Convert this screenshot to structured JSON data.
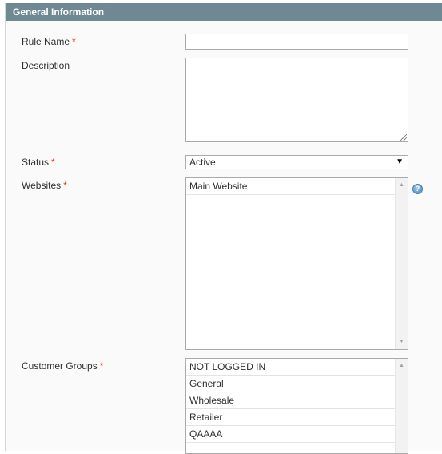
{
  "panel": {
    "title": "General Information"
  },
  "form": {
    "rule_name": {
      "label": "Rule Name",
      "required_mark": "*",
      "value": "",
      "placeholder": ""
    },
    "description": {
      "label": "Description",
      "value": ""
    },
    "status": {
      "label": "Status",
      "required_mark": "*",
      "selected": "Active"
    },
    "websites": {
      "label": "Websites",
      "required_mark": "*",
      "options": [
        "Main Website"
      ],
      "help_icon": "help-icon"
    },
    "customer_groups": {
      "label": "Customer Groups",
      "required_mark": "*",
      "options": [
        "NOT LOGGED IN",
        "General",
        "Wholesale",
        "Retailer",
        "QAAAA"
      ]
    }
  },
  "icons": {
    "dropdown": "chevron-down-icon",
    "scroll_up": "scroll-up-arrow-icon",
    "scroll_down": "scroll-down-arrow-icon",
    "help": "question-mark-icon"
  },
  "colors": {
    "header_bg": "#6f8992",
    "required": "#eb340a",
    "panel_bg": "#fafafa",
    "help_icon": "#4f88bf"
  }
}
